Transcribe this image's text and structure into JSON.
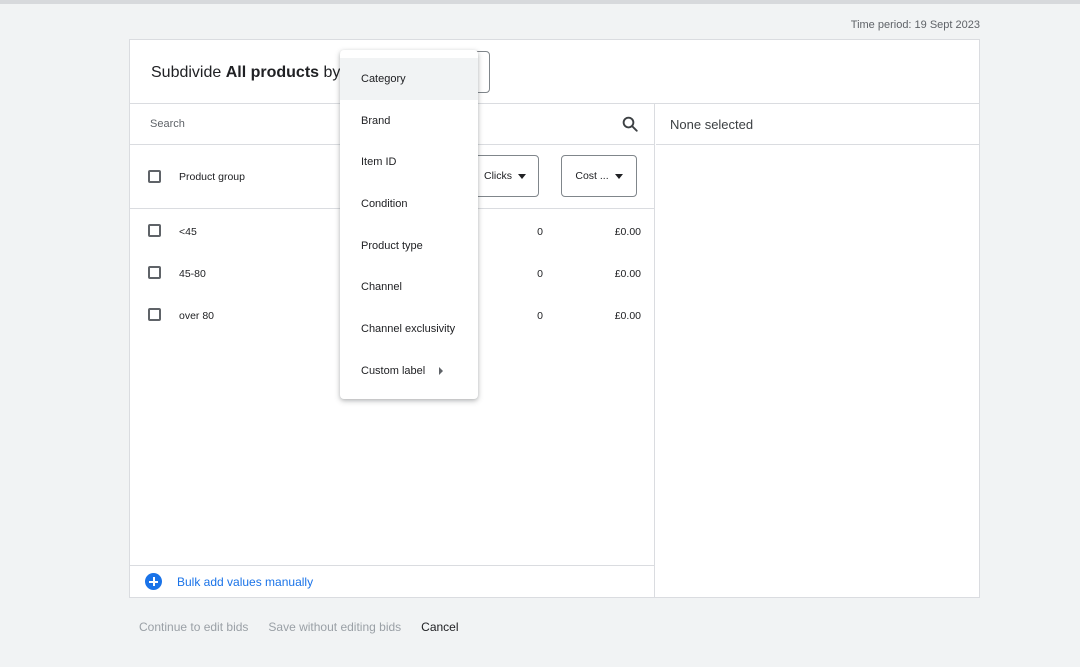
{
  "time_period": "Time period: 19 Sept 2023",
  "header": {
    "subdivide_prefix": "Subdivide ",
    "subdivide_bold": "All products",
    "subdivide_suffix": " by:"
  },
  "search": {
    "placeholder": "Search"
  },
  "right_pane": {
    "none_selected": "None selected"
  },
  "table": {
    "columns": {
      "product_group": "Product group",
      "clicks": "Clicks",
      "cost": "Cost ..."
    },
    "rows": [
      {
        "name": "<45",
        "clicks": "0",
        "cost": "£0.00"
      },
      {
        "name": "45-80",
        "clicks": "0",
        "cost": "£0.00"
      },
      {
        "name": "over 80",
        "clicks": "0",
        "cost": "£0.00"
      }
    ]
  },
  "bulk_add": {
    "label": "Bulk add values manually"
  },
  "footer": {
    "continue": "Continue to edit bids",
    "save_without": "Save without editing bids",
    "cancel": "Cancel"
  },
  "dropdown": {
    "items": [
      {
        "label": "Category",
        "highlighted": true
      },
      {
        "label": "Brand"
      },
      {
        "label": "Item ID"
      },
      {
        "label": "Condition"
      },
      {
        "label": "Product type"
      },
      {
        "label": "Channel"
      },
      {
        "label": "Channel exclusivity"
      },
      {
        "label": "Custom label",
        "has_submenu": true
      }
    ]
  },
  "colors": {
    "accent": "#1a73e8",
    "background": "#f1f3f4",
    "border": "#dadce0"
  }
}
